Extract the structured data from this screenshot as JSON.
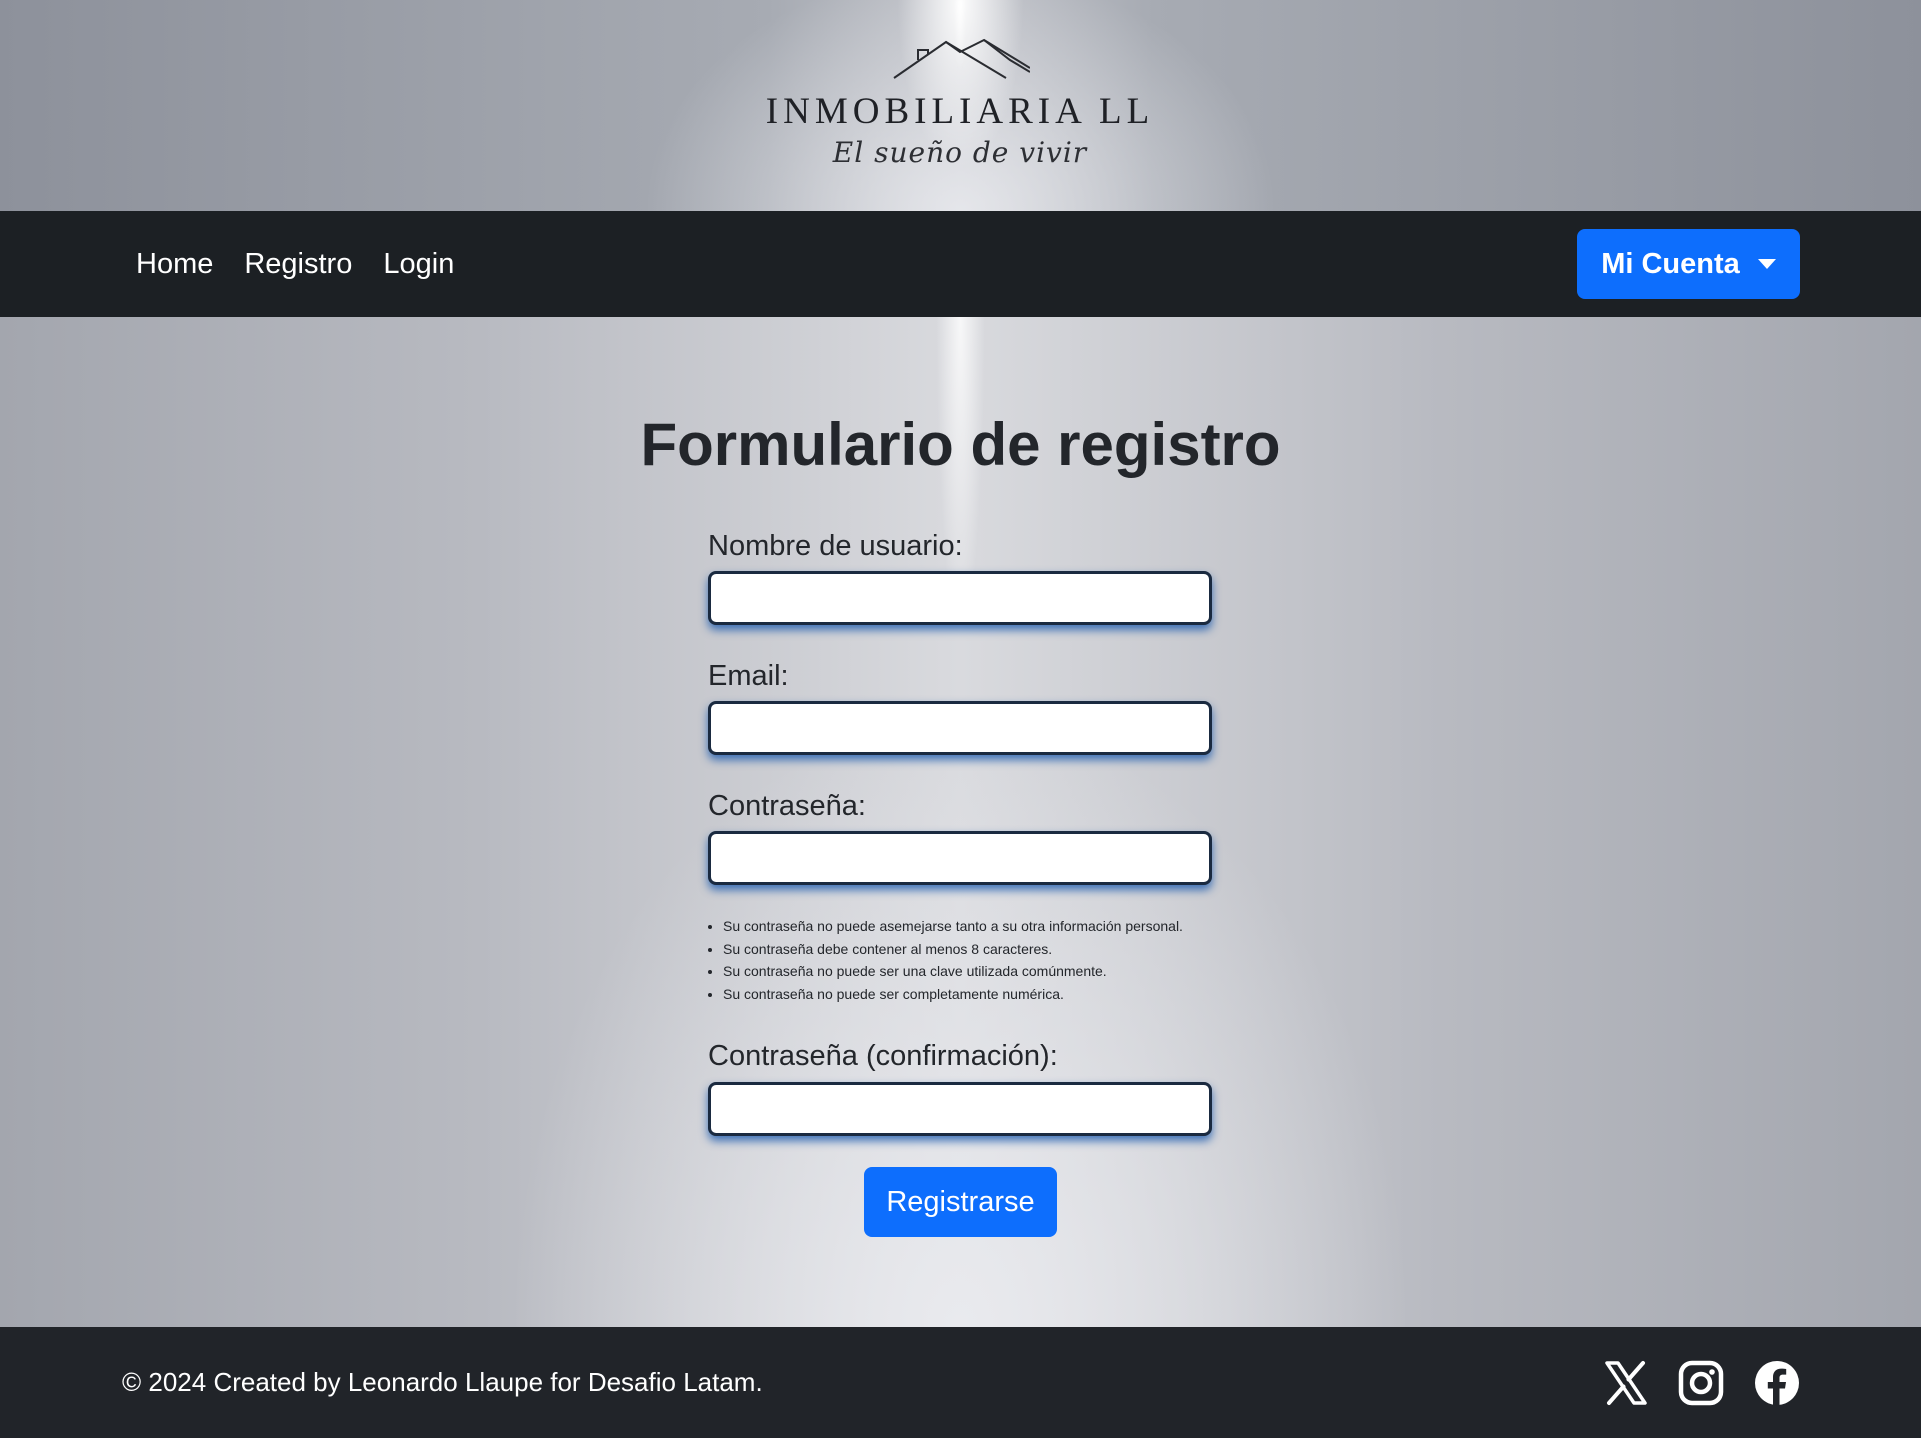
{
  "header": {
    "logo_title": "INMOBILIARIA LL",
    "logo_tagline": "El sueño de vivir"
  },
  "nav": {
    "links": [
      {
        "label": "Home"
      },
      {
        "label": "Registro"
      },
      {
        "label": "Login"
      }
    ],
    "account_label": "Mi Cuenta"
  },
  "form": {
    "title": "Formulario de registro",
    "fields": [
      {
        "label": "Nombre de usuario:",
        "value": ""
      },
      {
        "label": "Email:",
        "value": ""
      },
      {
        "label": "Contraseña:",
        "value": ""
      },
      {
        "label": "Contraseña (confirmación):",
        "value": ""
      }
    ],
    "password_help": [
      "Su contraseña no puede asemejarse tanto a su otra información personal.",
      "Su contraseña debe contener al menos 8 caracteres.",
      "Su contraseña no puede ser una clave utilizada comúnmente.",
      "Su contraseña no puede ser completamente numérica."
    ],
    "submit_label": "Registrarse"
  },
  "footer": {
    "text": "© 2024 Created by Leonardo Llaupe for Desafio Latam.",
    "social_icons": [
      "x-icon",
      "instagram-icon",
      "facebook-icon"
    ]
  },
  "colors": {
    "primary": "#0d6efd",
    "navbar": "#1c2024",
    "footer": "#212429"
  }
}
